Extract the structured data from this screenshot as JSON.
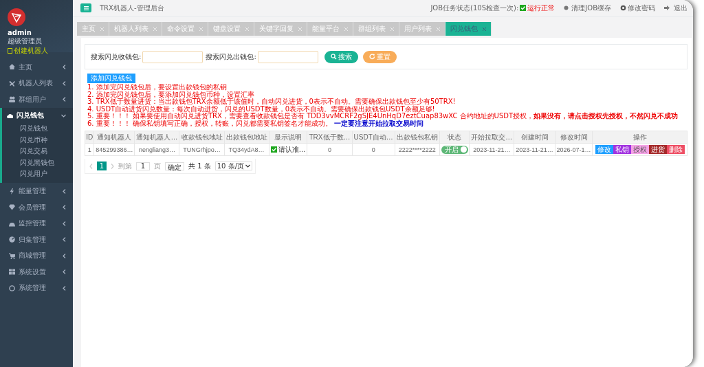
{
  "sidebar": {
    "user": {
      "name": "admin",
      "role": "超级管理员",
      "action": "创建机器人"
    },
    "menu": [
      {
        "label": "主页",
        "expanded": false
      },
      {
        "label": "机器人列表",
        "expanded": false
      },
      {
        "label": "群组用户",
        "expanded": false
      },
      {
        "label": "闪兑钱包",
        "expanded": true,
        "children": [
          {
            "label": "闪兑钱包"
          },
          {
            "label": "闪兑币种"
          },
          {
            "label": "闪兑交易"
          },
          {
            "label": "闪兑黑钱包"
          },
          {
            "label": "闪兑用户"
          }
        ]
      },
      {
        "label": "能量管理",
        "expanded": false
      },
      {
        "label": "会员管理",
        "expanded": false
      },
      {
        "label": "监控管理",
        "expanded": false
      },
      {
        "label": "归集管理",
        "expanded": false
      },
      {
        "label": "商城管理",
        "expanded": false
      },
      {
        "label": "系统设置",
        "expanded": false
      },
      {
        "label": "系统管理",
        "expanded": false
      }
    ]
  },
  "header": {
    "title": "TRX机器人-管理后台",
    "job_label": "JOB任务状态(10S检查一次):",
    "job_ok": true,
    "job_status": "运行正常",
    "links": [
      "清理JOB缓存",
      "修改密码",
      "退出"
    ]
  },
  "tabs": [
    {
      "label": "主页",
      "selected": false
    },
    {
      "label": "机器人列表",
      "selected": false
    },
    {
      "label": "命令设置",
      "selected": false
    },
    {
      "label": "键盘设置",
      "selected": false
    },
    {
      "label": "关键字回复",
      "selected": false
    },
    {
      "label": "能量平台",
      "selected": false
    },
    {
      "label": "群组列表",
      "selected": false
    },
    {
      "label": "用户列表",
      "selected": false
    },
    {
      "label": "闪兑钱包",
      "selected": true
    }
  ],
  "search": {
    "fields": [
      {
        "label": "搜索闪兑收钱包:"
      },
      {
        "label": "搜索闪兑出钱包:"
      }
    ],
    "buttons": [
      {
        "label": "搜索",
        "kind": "search"
      },
      {
        "label": "重置",
        "kind": "reset"
      }
    ]
  },
  "add_button": "添加闪兑钱包",
  "notes": [
    {
      "text": "1. 添加完闪兑钱包后，要设置出款钱包的私钥"
    },
    {
      "text": "2. 添加完闪兑钱包后，要添加闪兑钱包币种，设置汇率"
    },
    {
      "text": "3. TRX低于数量进货：当出款钱包TRX余额低于该值时，自动闪兑进货，0表示不自动。需要确保出款钱包至少有50TRX!"
    },
    {
      "text": "4. USDT自动进货闪兑数量：每次自动进货，闪兑的USDT数量，0表示不自动。需要确保出款钱包USDT余额足够!"
    },
    {
      "text": "5. 重要！！！ 如果要使用自动闪兑进货TRX，需要查看收款钱包是否有 TDD3vvMCRF2gSJE4UnHqD7eztCuap83wXC 合约地址的USDT授权，**如果没有，请点击授权先授权，不然闪兑不成功**"
    },
    {
      "text": "6. 重要！！！ 确保私钥填写正确，授权，转账，闪兑都需要私钥签名才能成功。",
      "emphasis": "一定要注意开始拉取交易时间"
    }
  ],
  "table": {
    "columns": [
      "ID",
      "通知机器人",
      "通知机器人…",
      "收款钱包地址",
      "出款钱包地址",
      "显示说明",
      "TRX低于数…",
      "USDT自动…",
      "出款钱包私钥",
      "状态",
      "开始拉取交…",
      "创建时间",
      "修改时间",
      "操作"
    ],
    "rows": [
      {
        "id": "1",
        "bot": "845299386…",
        "bot_name": "nengliang3…",
        "receive_address": "TUNGrhjpo…",
        "pay_address": "TQ34ydA8…",
        "display": {
          "checked": true,
          "text": "请认准…"
        },
        "trx_threshold": "0",
        "usdt_auto": "0",
        "private_key": "2222****2222",
        "status": {
          "on": true,
          "label": "开启"
        },
        "start_time": "2023-11-21…",
        "created": "2023-11-21…",
        "modified": "2026-07-1…",
        "actions": [
          {
            "label": "修改",
            "color": "#1e9fff"
          },
          {
            "label": "私钥",
            "color": "#a233e0"
          },
          {
            "label": "授权",
            "color": "#f5a3e6"
          },
          {
            "label": "进货",
            "color": "#a52a2a"
          },
          {
            "label": "删除",
            "color": "#ee4d63"
          }
        ]
      }
    ]
  },
  "pager": {
    "pages": [
      {
        "label": "1",
        "selected": true
      }
    ],
    "goto_label": "到第",
    "goto_value": "1",
    "page_unit": "页",
    "confirm": "确定",
    "total": "共 1 条",
    "page_size": "10 条/页"
  }
}
